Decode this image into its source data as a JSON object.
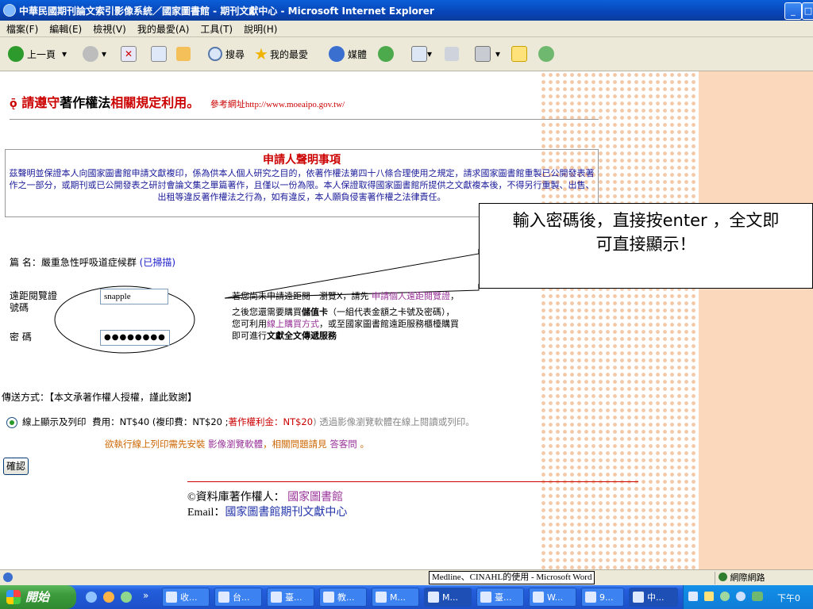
{
  "window": {
    "title": "中華民國期刊論文索引影像系統／國家圖書館 - 期刊文獻中心 - Microsoft Internet Explorer"
  },
  "menu": [
    "檔案(F)",
    "編輯(E)",
    "檢視(V)",
    "我的最愛(A)",
    "工具(T)",
    "說明(H)"
  ],
  "toolbar": {
    "back": "上一頁",
    "search": "搜尋",
    "favorites": "我的最愛",
    "media": "媒體"
  },
  "header": {
    "copyright_1": "請遵守",
    "copyright_2": "著作權法",
    "copyright_3": "相關規定利用。",
    "ref_label": "參考網址",
    "ref_url": "http://www.moeaipo.gov.tw/"
  },
  "notice": {
    "title": "申請人聲明事項",
    "body": "茲聲明並保證本人向國家圖書館申請文獻複印，係為供本人個人研究之目的，依著作權法第四十八條合理使用之規定，請求國家圖書館重製已公開發表著作之一部分，或期刊或已公開發表之研討會論文集之單篇著作，且僅以一份為限。本人保證取得國家圖書館所提供之文獻複本後，不得另行重製、出售、出租等違反著作權法之行為，如有違反，本人願負侵害著作權之法律責任。"
  },
  "callout": {
    "line1": "輸入密碼後，直接按enter ，全文即",
    "line2": "可直接顯示！"
  },
  "article": {
    "label": "篇 名：",
    "title": "嚴重急性呼吸道症候群",
    "scan": "(已掃描)"
  },
  "form": {
    "account_label_1": "遠距閱覽證",
    "account_label_2": "號碼",
    "account_value": "snapple",
    "password_label": "密 碼",
    "password_value": "●●●●●●●●"
  },
  "info": {
    "line1_a": "若您尚未申請遠距閱　瀏覽X，請先 ",
    "line1_link": "申請個人遠距閱覽證",
    "line1_b": "，",
    "line2_a": "之後您還需要購買",
    "line2_b": "儲值卡",
    "line2_c": "（一組代表金額之卡號及密碼），",
    "line3_a": "您可利用",
    "line3_link": "線上購買方式",
    "line3_b": "，或至國家圖書館遠距服務櫃檯購買",
    "line4_a": "即可進行",
    "line4_b": "文獻全文傳遞服務"
  },
  "delivery": {
    "label": "傳送方式：【本文承著作權人授權，謹此致謝】",
    "option": "線上顯示及列印",
    "fee_a": "費用：NT$40 (複印費：NT$20 ;",
    "fee_b": "著作權利金：NT$20",
    "fee_c": ") 透過影像瀏覽軟體在線上閱讀或列印。",
    "print_a": "欲執行線上列印需先安裝 ",
    "print_link": "影像瀏覽軟體",
    "print_b": "，相關問題請見 ",
    "print_link2": "答客問",
    "print_c": " 。"
  },
  "confirm_button": "確認",
  "footer": {
    "owner_label": "©資料庫著作權人：",
    "owner": "國家圖書館",
    "email_label": "Email：",
    "email": "國家圖書館期刊文獻中心"
  },
  "status": {
    "doc": "Medline、CINAHL的使用 - Microsoft Word",
    "zone": "網際網路"
  },
  "taskbar": {
    "start": "開始",
    "tasks": [
      "收...",
      "台...",
      "臺...",
      "教...",
      "M...",
      "M...",
      "臺...",
      "W...",
      "9...",
      "中..."
    ],
    "clock": "下午0"
  }
}
